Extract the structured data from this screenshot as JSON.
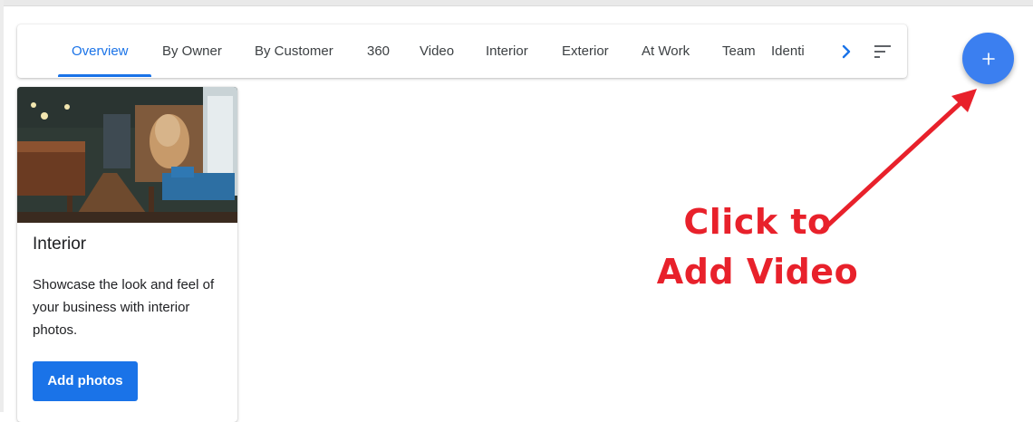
{
  "tabs": [
    {
      "label": "Overview",
      "active": true
    },
    {
      "label": "By Owner"
    },
    {
      "label": "By Customer"
    },
    {
      "label": "360"
    },
    {
      "label": "Video"
    },
    {
      "label": "Interior"
    },
    {
      "label": "Exterior"
    },
    {
      "label": "At Work"
    },
    {
      "label": "Team"
    },
    {
      "label": "Identi"
    }
  ],
  "icons": {
    "more_tabs": "chevron-right-icon",
    "sort": "sort-icon",
    "add": "plus-icon"
  },
  "card": {
    "title": "Interior",
    "description": "Showcase the look and feel of your business with interior photos.",
    "button_label": "Add photos"
  },
  "annotation": {
    "line1": "Click to",
    "line2": "Add Video"
  },
  "colors": {
    "accent": "#1a73e8",
    "fab": "#3b7ff0",
    "annotation": "#e8212b"
  }
}
